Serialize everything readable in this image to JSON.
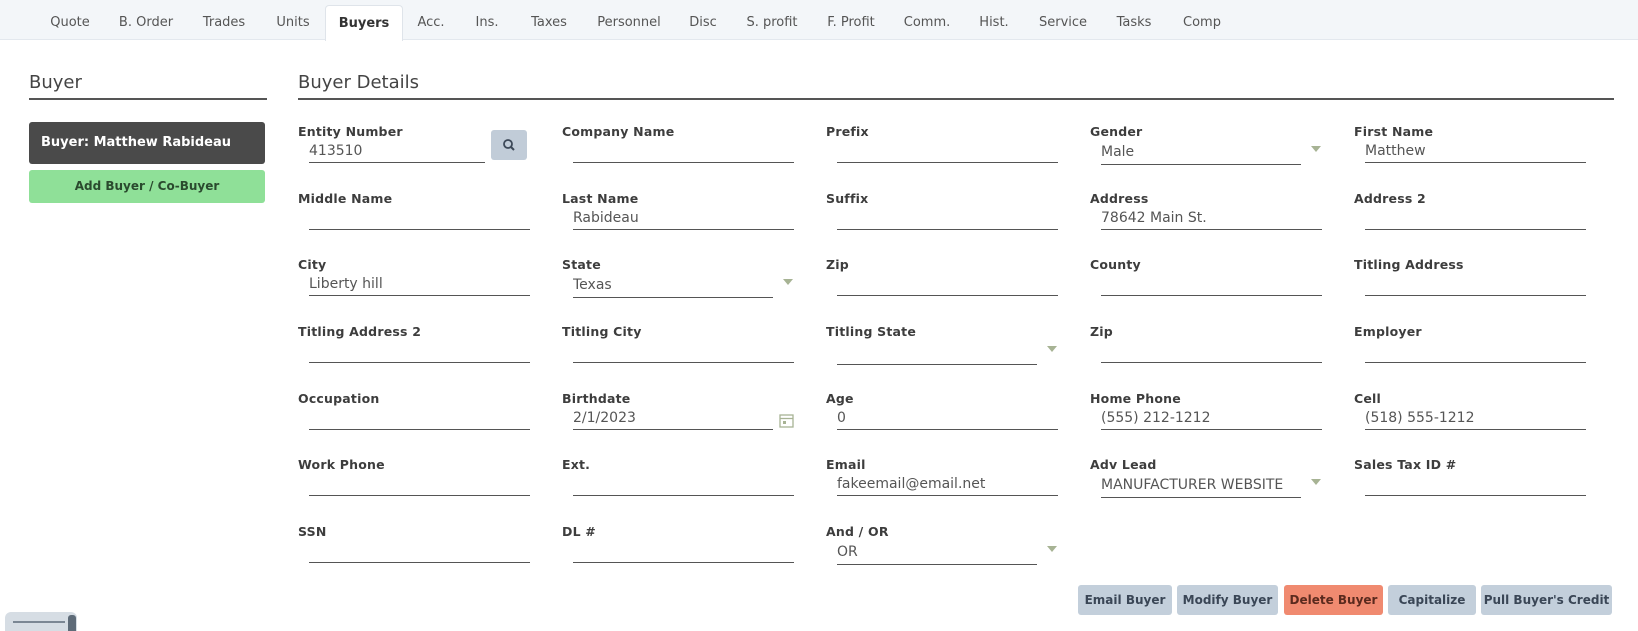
{
  "tabs": [
    {
      "label": "Quote",
      "active": false
    },
    {
      "label": "B. Order",
      "active": false
    },
    {
      "label": "Trades",
      "active": false
    },
    {
      "label": "Units",
      "active": false
    },
    {
      "label": "Buyers",
      "active": true
    },
    {
      "label": "Acc.",
      "active": false
    },
    {
      "label": "Ins.",
      "active": false
    },
    {
      "label": "Taxes",
      "active": false
    },
    {
      "label": "Personnel",
      "active": false
    },
    {
      "label": "Disc",
      "active": false
    },
    {
      "label": "S. profit",
      "active": false
    },
    {
      "label": "F. Profit",
      "active": false
    },
    {
      "label": "Comm.",
      "active": false
    },
    {
      "label": "Hist.",
      "active": false
    },
    {
      "label": "Service",
      "active": false
    },
    {
      "label": "Tasks",
      "active": false
    },
    {
      "label": "Comp",
      "active": false
    }
  ],
  "left_panel": {
    "title": "Buyer",
    "buyer_card": "Buyer: Matthew Rabideau",
    "add_button": "Add Buyer / Co-Buyer"
  },
  "details": {
    "title": "Buyer Details",
    "fields": {
      "entity_number": {
        "label": "Entity Number",
        "value": "413510"
      },
      "company_name": {
        "label": "Company Name",
        "value": ""
      },
      "prefix": {
        "label": "Prefix",
        "value": ""
      },
      "gender": {
        "label": "Gender",
        "value": "Male"
      },
      "first_name": {
        "label": "First Name",
        "value": "Matthew"
      },
      "middle_name": {
        "label": "Middle Name",
        "value": ""
      },
      "last_name": {
        "label": "Last Name",
        "value": "Rabideau"
      },
      "suffix": {
        "label": "Suffix",
        "value": ""
      },
      "address": {
        "label": "Address",
        "value": "78642 Main St."
      },
      "address2": {
        "label": "Address 2",
        "value": ""
      },
      "city": {
        "label": "City",
        "value": "Liberty hill"
      },
      "state": {
        "label": "State",
        "value": "Texas"
      },
      "zip": {
        "label": "Zip",
        "value": ""
      },
      "county": {
        "label": "County",
        "value": ""
      },
      "titling_address": {
        "label": "Titling Address",
        "value": ""
      },
      "titling_address2": {
        "label": "Titling Address 2",
        "value": ""
      },
      "titling_city": {
        "label": "Titling City",
        "value": ""
      },
      "titling_state": {
        "label": "Titling State",
        "value": ""
      },
      "titling_zip": {
        "label": "Zip",
        "value": ""
      },
      "employer": {
        "label": "Employer",
        "value": ""
      },
      "occupation": {
        "label": "Occupation",
        "value": ""
      },
      "birthdate": {
        "label": "Birthdate",
        "value": "2/1/2023"
      },
      "age": {
        "label": "Age",
        "value": "0"
      },
      "home_phone": {
        "label": "Home Phone",
        "value": "(555) 212-1212"
      },
      "cell": {
        "label": "Cell",
        "value": "(518) 555-1212"
      },
      "work_phone": {
        "label": "Work Phone",
        "value": ""
      },
      "ext": {
        "label": "Ext.",
        "value": ""
      },
      "email": {
        "label": "Email",
        "value": "fakeemail@email.net"
      },
      "adv_lead": {
        "label": "Adv Lead",
        "value": "MANUFACTURER WEBSITE"
      },
      "sales_tax_id": {
        "label": "Sales Tax ID #",
        "value": ""
      },
      "ssn": {
        "label": "SSN",
        "value": ""
      },
      "dl": {
        "label": "DL #",
        "value": ""
      },
      "and_or": {
        "label": "And / OR",
        "value": "OR"
      }
    }
  },
  "actions": {
    "email": "Email Buyer",
    "modify": "Modify Buyer",
    "delete": "Delete Buyer",
    "capitalize": "Capitalize",
    "pull_credit": "Pull Buyer's Credit"
  },
  "icons": {
    "search": "search-icon",
    "calendar": "calendar-icon",
    "dropdown": "chevron-down-icon"
  },
  "colors": {
    "add_button": "#8fe098",
    "delete_button": "#f08a70",
    "action_button": "#c3cfdb",
    "buyer_card": "#4a4a4a"
  }
}
